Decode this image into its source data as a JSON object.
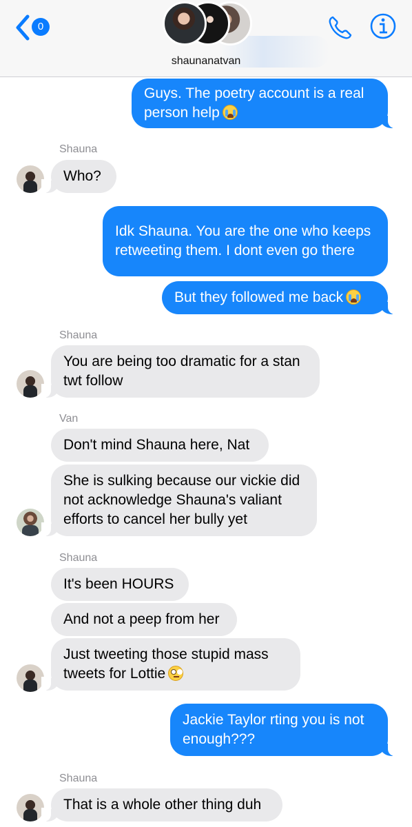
{
  "header": {
    "back_badge": "0",
    "group_name": "shaunanatvan",
    "icons": [
      "chevron-left-icon",
      "phone-icon",
      "info-icon"
    ],
    "accent_color": "#0a7cff"
  },
  "messages": [
    {
      "direction": "outgoing",
      "text": "Guys. The poetry account is a real person help",
      "emoji": "loudly-crying-face"
    },
    {
      "sender": "Shauna"
    },
    {
      "direction": "incoming",
      "text": "Who?"
    },
    {
      "direction": "outgoing",
      "text": "Idk Shauna. You are the one who keeps retweeting them. I dont even go there"
    },
    {
      "direction": "outgoing",
      "text": "But they followed me back",
      "emoji": "loudly-crying-face"
    },
    {
      "sender": "Shauna"
    },
    {
      "direction": "incoming",
      "text": "You are being too dramatic for a stan twt follow"
    },
    {
      "sender": "Van"
    },
    {
      "direction": "incoming",
      "text": "Don't mind Shauna here, Nat"
    },
    {
      "direction": "incoming",
      "text": "She is sulking because our vickie did not acknowledge Shauna's valiant efforts to cancel her bully yet"
    },
    {
      "sender": "Shauna"
    },
    {
      "direction": "incoming",
      "text": "It's been HOURS"
    },
    {
      "direction": "incoming",
      "text": "And not a peep from her"
    },
    {
      "direction": "incoming",
      "text": "Just  tweeting those stupid mass tweets for Lottie",
      "emoji": "face-with-rolling-eyes"
    },
    {
      "direction": "outgoing",
      "text": "Jackie Taylor rting you is not enough???"
    },
    {
      "sender": "Shauna"
    },
    {
      "direction": "incoming",
      "text": "That is a whole other thing duh"
    }
  ]
}
